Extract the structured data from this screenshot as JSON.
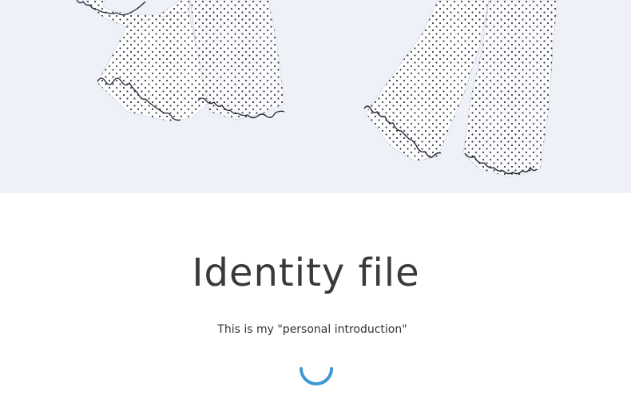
{
  "banner": {
    "image_description": "white polka-dot wide-leg pajama pants with lettuce-edge ruffled hems",
    "background_color": "#eef2f8",
    "fabric_color": "#ffffff",
    "dot_color": "#1f2430"
  },
  "intro": {
    "title": "Identity file",
    "subtitle": "This is my \"personal introduction\""
  },
  "loader": {
    "icon": "loading-spinner-icon",
    "color": "#3f97d6"
  }
}
